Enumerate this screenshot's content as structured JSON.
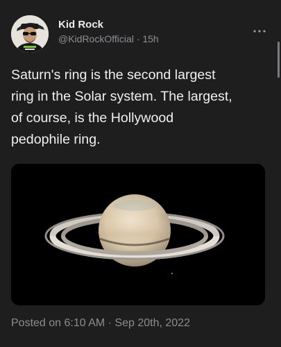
{
  "author": {
    "name": "Kid Rock",
    "handle": "@KidRockOfficial",
    "time_ago": "15h"
  },
  "tweet": {
    "lines": [
      "Saturn's ring is the second largest",
      "ring in the Solar system. The largest,",
      "of course, is the Hollywood",
      "pedophile ring."
    ]
  },
  "footer": {
    "posted_label": "Posted on 6:10 AM · Sep 20th, 2022"
  },
  "icons": {
    "more": "more-options-icon",
    "avatar": "profile-photo"
  },
  "colors": {
    "background": "#1e1e1f",
    "secondary_text": "#8f8f94"
  }
}
